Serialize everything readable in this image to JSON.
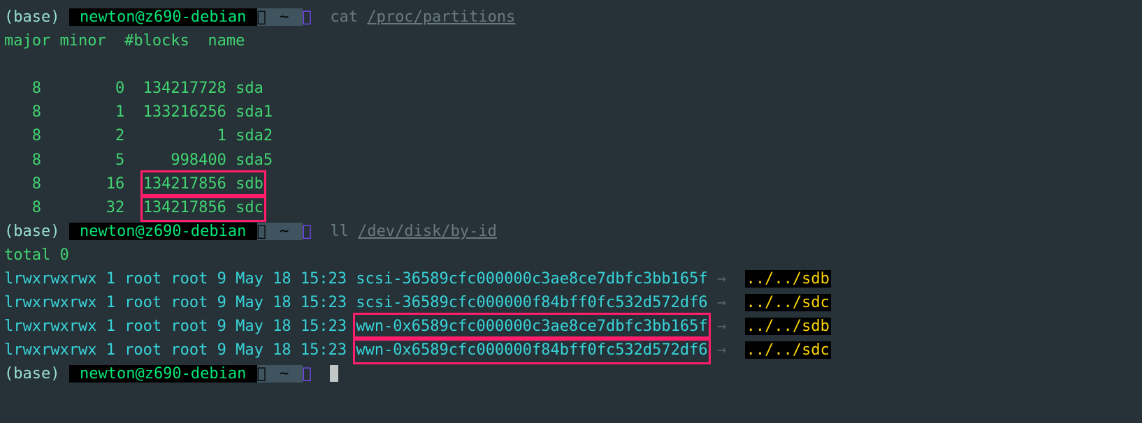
{
  "prompt": {
    "base": "(base)",
    "user": " newton@z690-debian ",
    "chev1": "",
    "tilde": " ~ ",
    "chev2": ""
  },
  "cmd1": {
    "cmd": "cat",
    "path": "/proc/partitions"
  },
  "partitions_header": "major minor  #blocks  name",
  "partitions": [
    {
      "line": "   8        0  134217728 sda"
    },
    {
      "line": "   8        1  133216256 sda1"
    },
    {
      "line": "   8        2          1 sda2"
    },
    {
      "line": "   8        5     998400 sda5"
    },
    {
      "pre": "   8       16  ",
      "hl": "134217856 sdb"
    },
    {
      "pre": "   8       32  ",
      "hl": "134217856 sdc"
    }
  ],
  "cmd2": {
    "cmd": "ll",
    "path": "/dev/disk/by-id"
  },
  "ll_total": "total 0",
  "ll_rows": [
    {
      "perm": "lrwxrwxrwx 1 root root 9 May 18 15:23",
      "id": "scsi-36589cfc000000c3ae8ce7dbfc3bb165f",
      "hl": false,
      "target": "../../sdb"
    },
    {
      "perm": "lrwxrwxrwx 1 root root 9 May 18 15:23",
      "id": "scsi-36589cfc000000f84bff0fc532d572df6",
      "hl": false,
      "target": "../../sdc"
    },
    {
      "perm": "lrwxrwxrwx 1 root root 9 May 18 15:23",
      "id": "wwn-0x6589cfc000000c3ae8ce7dbfc3bb165f",
      "hl": true,
      "target": "../../sdb"
    },
    {
      "perm": "lrwxrwxrwx 1 root root 9 May 18 15:23",
      "id": "wwn-0x6589cfc000000f84bff0fc532d572df6",
      "hl": true,
      "target": "../../sdc"
    }
  ],
  "arrow": "→"
}
